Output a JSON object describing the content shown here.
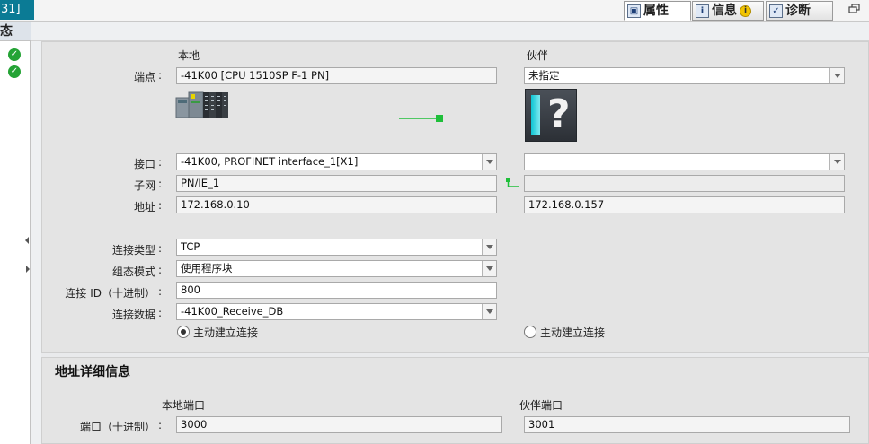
{
  "topbar": {
    "left_fragment": "31]",
    "tabs": [
      {
        "label": "属性",
        "icon": "properties-icon",
        "active": true
      },
      {
        "label": "信息",
        "icon": "info-icon",
        "active": false
      },
      {
        "label": "诊断",
        "icon": "diagnostics-icon",
        "active": false
      }
    ],
    "info_badge": "i"
  },
  "left_pane": {
    "header": "态"
  },
  "connection": {
    "col_local": "本地",
    "col_partner": "伙伴",
    "endpoint": {
      "label": "端点",
      "local": "-41K00 [CPU 1510SP F-1 PN]",
      "partner": "未指定"
    },
    "interface": {
      "label": "接口",
      "local": "-41K00, PROFINET interface_1[X1]",
      "partner": ""
    },
    "subnet": {
      "label": "子网",
      "local": "PN/IE_1",
      "partner": ""
    },
    "address": {
      "label": "地址",
      "local": "172.168.0.10",
      "partner": "172.168.0.157"
    },
    "conn_type": {
      "label": "连接类型",
      "value": "TCP"
    },
    "config_mode": {
      "label": "组态模式",
      "value": "使用程序块"
    },
    "conn_id": {
      "label": "连接 ID（十进制）",
      "value": "800"
    },
    "conn_data": {
      "label": "连接数据",
      "value": "-41K00_Receive_DB"
    },
    "active_local": {
      "label": "主动建立连接",
      "checked": true
    },
    "active_partner": {
      "label": "主动建立连接",
      "checked": false
    },
    "partner_device_glyph": "?",
    "colon": ":"
  },
  "address_details": {
    "title": "地址详细信息",
    "col_local_port": "本地端口",
    "col_partner_port": "伙伴端口",
    "port": {
      "label": "端口（十进制）",
      "local": "3000",
      "partner": "3001"
    }
  },
  "colors": {
    "accent_teal": "#0b7b95",
    "ok_green": "#24a335",
    "link_green": "#1fbf3a",
    "panel_bg": "#e4e4e4"
  }
}
